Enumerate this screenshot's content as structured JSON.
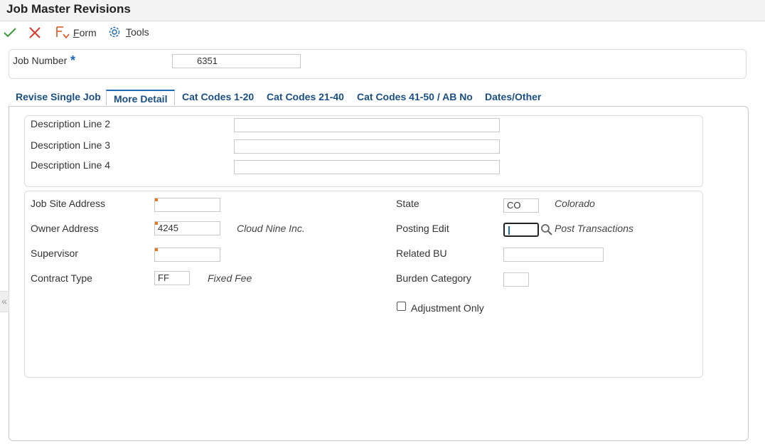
{
  "window": {
    "title": "Job Master Revisions"
  },
  "toolbar": {
    "ok_icon": "checkmark-icon",
    "cancel_icon": "close-icon",
    "form_label_prefix": "F",
    "form_label_rest": "orm",
    "tools_label_prefix": "T",
    "tools_label_rest": "ools"
  },
  "header": {
    "job_number_label": "Job Number",
    "required_mark": "*",
    "job_number_value": "6351"
  },
  "tabs": [
    {
      "label": "Revise Single Job"
    },
    {
      "label": "More Detail",
      "active": true
    },
    {
      "label": "Cat Codes 1-20"
    },
    {
      "label": "Cat Codes 21-40"
    },
    {
      "label": "Cat Codes 41-50 / AB No"
    },
    {
      "label": "Dates/Other"
    }
  ],
  "descriptions": {
    "line2_label": "Description Line 2",
    "line2_value": "",
    "line3_label": "Description Line 3",
    "line3_value": "",
    "line4_label": "Description Line 4",
    "line4_value": ""
  },
  "details": {
    "job_site_address_label": "Job Site Address",
    "job_site_address_value": "",
    "owner_address_label": "Owner Address",
    "owner_address_value": "4245",
    "owner_address_desc": "Cloud Nine Inc.",
    "supervisor_label": "Supervisor",
    "supervisor_value": "",
    "contract_type_label": "Contract Type",
    "contract_type_value": "FF",
    "contract_type_desc": "Fixed Fee",
    "state_label": "State",
    "state_value": "CO",
    "state_desc": "Colorado",
    "posting_edit_label": "Posting Edit",
    "posting_edit_value": "",
    "posting_edit_desc": "Post Transactions",
    "related_bu_label": "Related BU",
    "related_bu_value": "",
    "burden_category_label": "Burden Category",
    "burden_category_value": "",
    "adjustment_only_label": "Adjustment Only",
    "adjustment_only_checked": false
  },
  "colors": {
    "accent": "#1a6ab5",
    "flag": "#e07a20",
    "ok": "#3a9a3a",
    "cancel": "#d93a2b"
  }
}
